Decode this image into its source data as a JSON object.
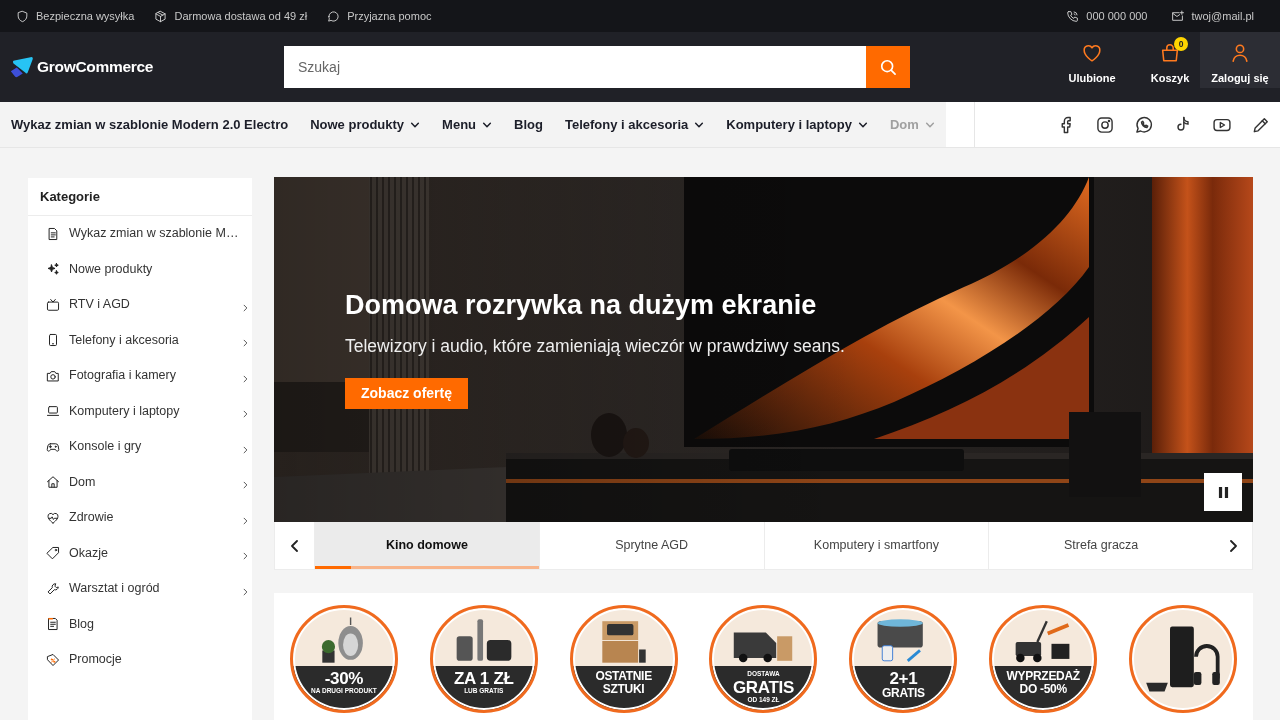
{
  "top_bar": {
    "features": [
      {
        "label": "Bezpieczna wysyłka"
      },
      {
        "label": "Darmowa dostawa od 49 zł"
      },
      {
        "label": "Przyjazna pomoc"
      }
    ],
    "contacts": [
      {
        "kind": "phone",
        "label": "000 000 000"
      },
      {
        "kind": "email",
        "label": "twoj@mail.pl"
      }
    ]
  },
  "header": {
    "logo": "GrowCommerce",
    "search": {
      "placeholder": "Szukaj"
    },
    "actions": [
      {
        "kind": "favorites",
        "label": "Ulubione"
      },
      {
        "kind": "cart",
        "label": "Koszyk",
        "badge": "0"
      },
      {
        "kind": "account",
        "label": "Zaloguj się"
      }
    ]
  },
  "nav": {
    "items": [
      {
        "label": "Wykaz zmian w szablonie Modern 2.0 Electro",
        "dropdown": false
      },
      {
        "label": "Nowe produkty",
        "dropdown": true
      },
      {
        "label": "Menu",
        "dropdown": true
      },
      {
        "label": "Blog",
        "dropdown": false
      },
      {
        "label": "Telefony i akcesoria",
        "dropdown": true
      },
      {
        "label": "Komputery i laptopy",
        "dropdown": true
      },
      {
        "label": "Dom",
        "dropdown": true
      }
    ]
  },
  "sidebar": {
    "title": "Kategorie",
    "items": [
      {
        "label": "Wykaz zmian w szablonie M…",
        "expandable": false
      },
      {
        "label": "Nowe produkty",
        "expandable": false
      },
      {
        "label": "RTV i AGD",
        "expandable": true
      },
      {
        "label": "Telefony i akcesoria",
        "expandable": true
      },
      {
        "label": "Fotografia i kamery",
        "expandable": true
      },
      {
        "label": "Komputery i laptopy",
        "expandable": true
      },
      {
        "label": "Konsole i gry",
        "expandable": true
      },
      {
        "label": "Dom",
        "expandable": true
      },
      {
        "label": "Zdrowie",
        "expandable": true
      },
      {
        "label": "Okazje",
        "expandable": true
      },
      {
        "label": "Warsztat i ogród",
        "expandable": true
      },
      {
        "label": "Blog",
        "expandable": false
      },
      {
        "label": "Promocje",
        "expandable": false
      }
    ]
  },
  "hero": {
    "title": "Domowa rozrywka na dużym ekranie",
    "subtitle": "Telewizory i audio, które zamieniają wieczór w prawdziwy seans.",
    "button": "Zobacz ofertę",
    "playing": true,
    "progress": {
      "level": 0.16
    },
    "tabs": [
      {
        "label": "Kino domowe",
        "selected": true
      },
      {
        "label": "Sprytne AGD",
        "selected": false
      },
      {
        "label": "Komputery i smartfony",
        "selected": false
      },
      {
        "label": "Strefa gracza",
        "selected": false
      }
    ]
  },
  "promos": [
    {
      "kind": "chair",
      "lines": [
        {
          "text": "-30%",
          "kind": "large"
        },
        {
          "text": "NA DRUGI PRODUKT",
          "kind": "small"
        }
      ]
    },
    {
      "kind": "kitchen",
      "lines": [
        {
          "text": "ZA 1 ZŁ",
          "kind": "large"
        },
        {
          "text": "LUB GRATIS",
          "kind": "small"
        }
      ]
    },
    {
      "kind": "boxes",
      "lines": [
        {
          "text": "OSTATNIE",
          "kind": "medium"
        },
        {
          "text": "SZTUKI",
          "kind": "medium"
        }
      ]
    },
    {
      "kind": "van",
      "lines": [
        {
          "text": "DOSTAWA",
          "kind": "small"
        },
        {
          "text": "GRATIS",
          "kind": "large"
        },
        {
          "text": "OD 149 ZŁ",
          "kind": "small"
        }
      ]
    },
    {
      "kind": "pool",
      "lines": [
        {
          "text": "2+1",
          "kind": "large"
        },
        {
          "text": "GRATIS",
          "kind": "medium"
        }
      ]
    },
    {
      "kind": "mower",
      "lines": [
        {
          "text": "WYPRZEDAŻ",
          "kind": "medium"
        },
        {
          "text": "DO -50%",
          "kind": "medium"
        }
      ]
    },
    {
      "kind": "console"
    }
  ]
}
